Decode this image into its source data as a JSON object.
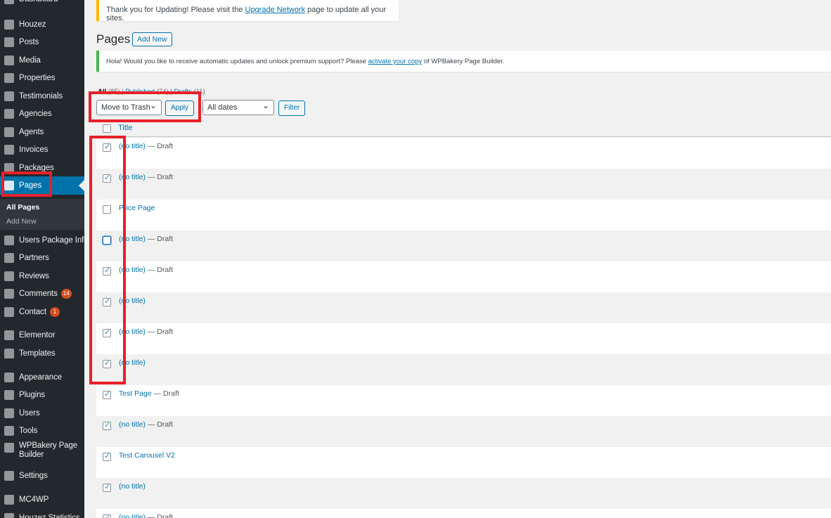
{
  "sidebar": {
    "items": [
      {
        "label": "Dashboard",
        "icon": "dashboard-icon"
      },
      {
        "label": "Houzez",
        "icon": "gear-icon"
      },
      {
        "label": "Posts",
        "icon": "pin-icon"
      },
      {
        "label": "Media",
        "icon": "media-icon"
      },
      {
        "label": "Properties",
        "icon": "location-icon"
      },
      {
        "label": "Testimonials",
        "icon": "person-icon"
      },
      {
        "label": "Agencies",
        "icon": "pin-icon"
      },
      {
        "label": "Agents",
        "icon": "person-icon"
      },
      {
        "label": "Invoices",
        "icon": "book-icon"
      },
      {
        "label": "Packages",
        "icon": "package-icon"
      },
      {
        "label": "Pages",
        "icon": "pages-icon"
      },
      {
        "label": "Users Package Info",
        "icon": "id-card-icon"
      },
      {
        "label": "Partners",
        "icon": "partners-icon"
      },
      {
        "label": "Reviews",
        "icon": "pin-icon"
      },
      {
        "label": "Comments",
        "icon": "comment-icon",
        "badge": "14"
      },
      {
        "label": "Contact",
        "icon": "mail-icon",
        "badge": "1"
      },
      {
        "label": "Elementor",
        "icon": "elementor-icon"
      },
      {
        "label": "Templates",
        "icon": "folder-icon"
      },
      {
        "label": "Appearance",
        "icon": "brush-icon"
      },
      {
        "label": "Plugins",
        "icon": "plug-icon"
      },
      {
        "label": "Users",
        "icon": "person-icon"
      },
      {
        "label": "Tools",
        "icon": "wrench-icon"
      },
      {
        "label": "WPBakery Page Builder",
        "icon": "cloud-icon"
      },
      {
        "label": "Settings",
        "icon": "settings-icon"
      },
      {
        "label": "MC4WP",
        "icon": "mc4wp-icon"
      },
      {
        "label": "Houzez Statistics",
        "icon": "chart-icon"
      }
    ],
    "submenu": {
      "all_pages": "All Pages",
      "add_new": "Add New"
    }
  },
  "notices": {
    "update_text_before": "Thank you for Updating! Please visit the ",
    "update_link": "Upgrade Network",
    "update_text_after": " page to update all your sites.",
    "wpb_text_before": "Hola! Would you like to receive automatic updates and unlock premium support? Please ",
    "wpb_link": "activate your copy",
    "wpb_text_after": " of WPBakery Page Builder."
  },
  "header": {
    "title": "Pages",
    "add_new": "Add New"
  },
  "views": {
    "all": "All",
    "all_count": "(85)",
    "published": "Published",
    "published_count": "(74)",
    "drafts": "Drafts",
    "drafts_count": "(11)"
  },
  "toolbar": {
    "bulk_action": "Move to Trash",
    "apply": "Apply",
    "dates": "All dates",
    "filter": "Filter"
  },
  "table": {
    "title_header": "Title",
    "rows": [
      {
        "title": "(no title)",
        "state": " — Draft",
        "checked": true
      },
      {
        "title": "(no title)",
        "state": " — Draft",
        "checked": true
      },
      {
        "title": "Price Page",
        "state": "",
        "checked": false
      },
      {
        "title": "(no title)",
        "state": " — Draft",
        "checked": false
      },
      {
        "title": "(no title)",
        "state": " — Draft",
        "checked": true
      },
      {
        "title": "(no title)",
        "state": "",
        "checked": true
      },
      {
        "title": "(no title)",
        "state": " — Draft",
        "checked": true
      },
      {
        "title": "(no title)",
        "state": "",
        "checked": true
      },
      {
        "title": "Test Page",
        "state": " — Draft",
        "checked": true
      },
      {
        "title": "(no title)",
        "state": " — Draft",
        "checked": true
      },
      {
        "title": "Test Carousel V2",
        "state": "",
        "checked": true
      },
      {
        "title": "(no title)",
        "state": "",
        "checked": true
      },
      {
        "title": "(no title)",
        "state": " — Draft",
        "checked": true
      }
    ]
  },
  "colors": {
    "highlight": "#e8202a",
    "accent": "#0073aa",
    "sidebar": "#23282d"
  }
}
